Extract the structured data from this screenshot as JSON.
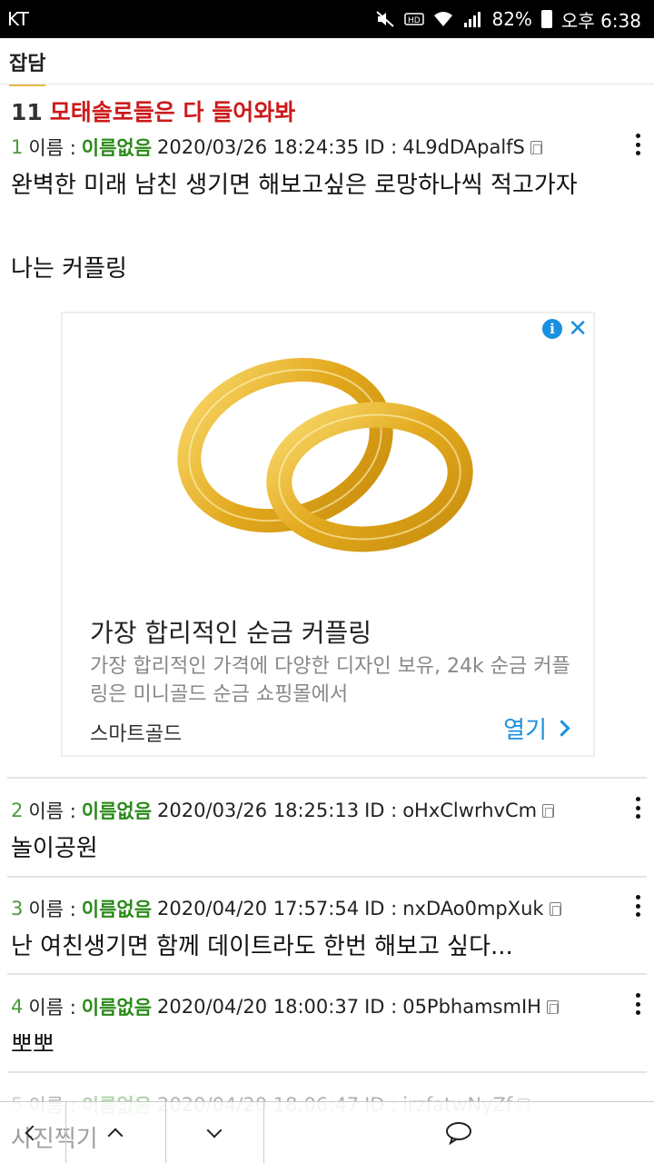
{
  "status_bar": {
    "carrier": "KT",
    "battery": "82%",
    "time": "오후 6:38"
  },
  "board_tab": "잡담",
  "thread": {
    "number": "11",
    "title": "모태솔로들은 다 들어와봐"
  },
  "labels": {
    "name_prefix": "이름 :",
    "id_prefix": "ID :"
  },
  "posts": [
    {
      "num": "1",
      "name": "이름없음",
      "date": "2020/03/26 18:24:35",
      "id": "4L9dDApalfS",
      "body": [
        "완벽한 미래 남친 생기면 해보고싶은 로망하나씩 적고가자",
        "나는 커플링"
      ]
    },
    {
      "num": "2",
      "name": "이름없음",
      "date": "2020/03/26 18:25:13",
      "id": "oHxClwrhvCm",
      "body": [
        "놀이공원"
      ]
    },
    {
      "num": "3",
      "name": "이름없음",
      "date": "2020/04/20 17:57:54",
      "id": "nxDAo0mpXuk",
      "body": [
        "난 여친생기면 함께 데이트라도 한번 해보고 싶다..."
      ]
    },
    {
      "num": "4",
      "name": "이름없음",
      "date": "2020/04/20 18:00:37",
      "id": "05PbhamsmIH",
      "body": [
        "뽀뽀"
      ]
    },
    {
      "num": "5",
      "name": "이름없음",
      "date": "2020/04/20 18:06:47",
      "id": "irzfatwNyZf",
      "body": []
    }
  ],
  "ad": {
    "info_icon": "i",
    "close_icon": "✕",
    "headline": "가장 합리적인 순금 커플링",
    "description": "가장 합리적인 가격에 다양한 디자인 보유, 24k 순금 커플링은 미니골드 순금 쇼핑몰에서",
    "brand": "스마트골드",
    "open_label": "열기",
    "colors": {
      "accent": "#1a8fe0",
      "gold": "#e8b32a"
    }
  },
  "bottom_bar": {
    "label": "사진찍기"
  }
}
